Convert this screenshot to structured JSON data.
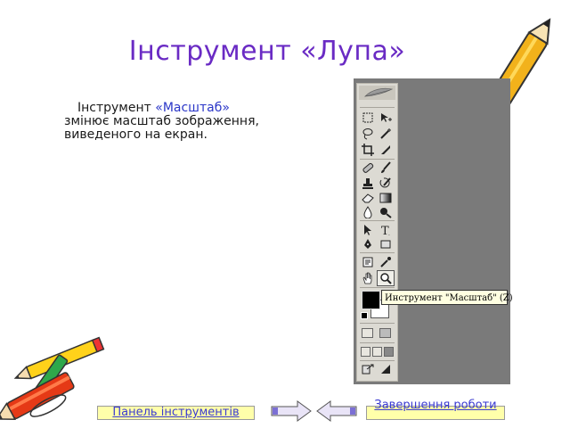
{
  "title": "Інструмент «Лупа»",
  "description": {
    "part1": "Інструмент ",
    "highlight": "«Масштаб»",
    "part2": " змінює масштаб зображення, виведеного на екран."
  },
  "screenshot": {
    "tooltip": "Инструмент \"Масштаб\" (Z)",
    "tools": [
      "marquee-icon",
      "move-icon",
      "lasso-icon",
      "magic-wand-icon",
      "crop-icon",
      "slice-icon",
      "healing-brush-icon",
      "brush-icon",
      "clone-stamp-icon",
      "history-brush-icon",
      "eraser-icon",
      "gradient-icon",
      "blur-icon",
      "dodge-icon",
      "path-selection-icon",
      "text-icon",
      "pen-icon",
      "shape-icon",
      "notes-icon",
      "eyedropper-icon",
      "hand-icon",
      "zoom-icon"
    ]
  },
  "nav": {
    "left_label": "Панель інструментів",
    "right_label": "Завершення роботи"
  },
  "colors": {
    "title": "#6a2bc4",
    "highlight": "#2a36c8",
    "nav_bg": "#ffffaa",
    "nav_text": "#3b3bd1"
  }
}
